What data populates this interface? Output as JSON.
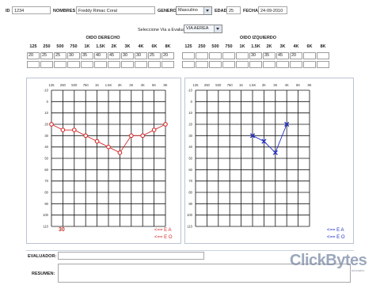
{
  "header": {
    "id_label": "ID",
    "id_value": "1234",
    "name_label": "NOMBRES",
    "name_value": "Freddy Rimac Coral",
    "gender_label": "GENERO",
    "gender_value": "Masculino",
    "age_label": "EDAD",
    "age_value": "25",
    "date_label": "FECHA",
    "date_value": "24-09-2010"
  },
  "via": {
    "label": "Seleccione Via a Evaluar:",
    "value": "VIA AEREA"
  },
  "right_ear": {
    "title": "OIDO DERECHO",
    "freqs": [
      "125",
      "250",
      "500",
      "750",
      "1K",
      "1.5K",
      "2K",
      "3K",
      "4K",
      "6K",
      "8K"
    ],
    "row1": [
      "20",
      "25",
      "25",
      "30",
      "35",
      "40",
      "45",
      "30",
      "30",
      "25",
      "20"
    ],
    "row2": [
      "",
      "",
      "",
      "",
      "",
      "",
      "",
      "",
      "",
      "",
      ""
    ]
  },
  "left_ear": {
    "title": "OIDO IZQUIERDO",
    "freqs": [
      "125",
      "250",
      "500",
      "750",
      "1K",
      "1.5K",
      "2K",
      "3K",
      "4K",
      "6K",
      "8K"
    ],
    "row1": [
      "",
      "",
      "",
      "",
      "",
      "30",
      "35",
      "45",
      "20",
      "",
      ""
    ],
    "row2": [
      "",
      "",
      "",
      "",
      "",
      "",
      "",
      "",
      "",
      "",
      ""
    ]
  },
  "chart_labels": {
    "x_ticks": [
      "125",
      "250",
      "500",
      "750",
      "1K",
      "1.5K",
      "2K",
      "3K",
      "4K",
      "6K",
      "8K"
    ],
    "y_ticks": [
      "-10",
      "0",
      "10",
      "20",
      "30",
      "40",
      "50",
      "60",
      "70",
      "80",
      "90",
      "100",
      "110"
    ]
  },
  "chart_data": [
    {
      "type": "line",
      "x": [
        "125",
        "250",
        "500",
        "750",
        "1K",
        "1.5K",
        "2K",
        "3K",
        "4K",
        "6K",
        "8K"
      ],
      "series": [
        {
          "name": "",
          "values": [
            20,
            25,
            25,
            30,
            35,
            40,
            45,
            30,
            30,
            25,
            20
          ]
        }
      ],
      "ylim": [
        -10,
        110
      ],
      "y_inverted": true,
      "marker": "circle",
      "color": "#d62c2c"
    },
    {
      "type": "line",
      "x": [
        "1.5K",
        "2K",
        "3K",
        "4K"
      ],
      "series": [
        {
          "name": "",
          "values": [
            30,
            35,
            45,
            20
          ]
        }
      ],
      "ylim": [
        -10,
        110
      ],
      "y_inverted": true,
      "marker": "x",
      "color": "#2430c8"
    }
  ],
  "right_score": "30",
  "legend_right": {
    "line1": "<== E  A",
    "line2": "<== E  O"
  },
  "legend_left": {
    "line1": "<== E  A",
    "line2": "<== E  O"
  },
  "footer": {
    "evaluator_label": "EVALUADOR:",
    "evaluator_value": "",
    "summary_label": "RESUMEN:",
    "summary_value": ""
  },
  "watermark": {
    "text": "ClickBytes",
    "sub": "tutoriales"
  },
  "colors": {
    "right": "#d62c2c",
    "left": "#2430c8",
    "grid": "#111111"
  }
}
